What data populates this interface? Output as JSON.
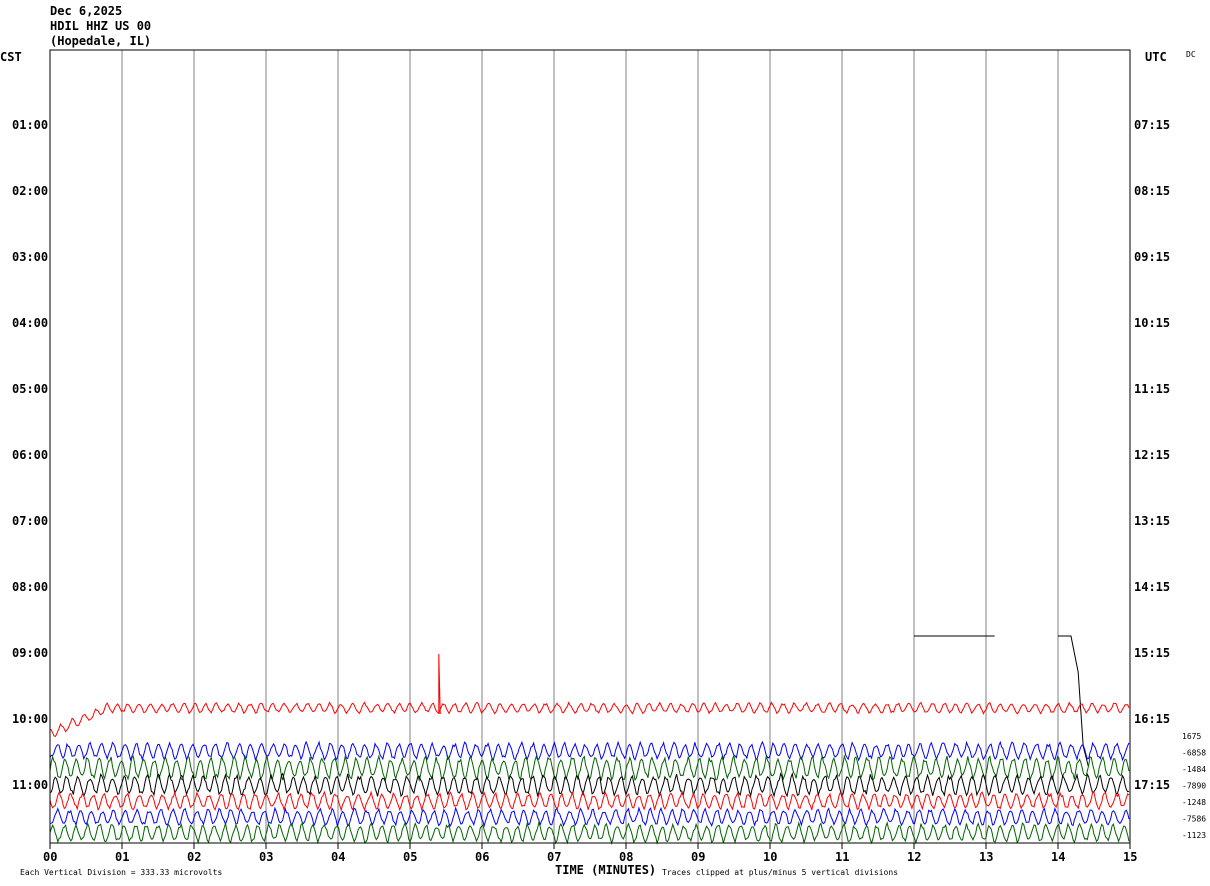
{
  "header": {
    "date": "Dec 6,2025",
    "station": "HDIL HHZ US 00",
    "location": "(Hopedale, IL)"
  },
  "left_axis_title": "CST",
  "right_axis_title": "UTC",
  "corner_tag": "DC",
  "footer": {
    "scale_note": "Each Vertical Division =  333.33 microvolts",
    "xlabel": "TIME (MINUTES)",
    "clip_note": "Traces clipped at plus/minus 5 vertical divisions"
  },
  "chart_data": {
    "type": "line",
    "subtype": "helicorder",
    "xlabel": "TIME (MINUTES)",
    "xlim": [
      0,
      15
    ],
    "x_ticks": [
      "00",
      "01",
      "02",
      "03",
      "04",
      "05",
      "06",
      "07",
      "08",
      "09",
      "10",
      "11",
      "12",
      "13",
      "14",
      "15"
    ],
    "left_hours": [
      "01:00",
      "02:00",
      "03:00",
      "04:00",
      "05:00",
      "06:00",
      "07:00",
      "08:00",
      "09:00",
      "10:00",
      "11:00"
    ],
    "right_hours": [
      "07:15",
      "08:15",
      "09:15",
      "10:15",
      "11:15",
      "12:15",
      "13:15",
      "14:15",
      "15:15",
      "16:15",
      "17:15"
    ],
    "gridlines": "vertical every minute",
    "trace_colors": [
      "#000000",
      "#ff0000",
      "#0000ff",
      "#006400"
    ],
    "active_traces": [
      {
        "row_start": "09:45 CST",
        "color": "#000000",
        "note": "flat line segments with gap (12–13.1 min, 14–14.2 min), then drop near 14.4 min"
      },
      {
        "row_start": "10:00 CST",
        "color": "#ff0000",
        "note": "noisy trace, spike near 5.4 min"
      },
      {
        "row_start": "10:30 CST",
        "color": "#0000ff"
      },
      {
        "row_start": "10:45 CST",
        "color": "#006400"
      },
      {
        "row_start": "11:00 CST",
        "color": "#000000"
      },
      {
        "row_start": "11:15 CST",
        "color": "#ff0000"
      },
      {
        "row_start": "11:30 CST",
        "color": "#0000ff"
      },
      {
        "row_start": "11:45 CST",
        "color": "#006400"
      }
    ],
    "right_values": [
      "1675",
      "-6858",
      "-1484",
      "-7890",
      "-1248",
      "-7586",
      "-1123"
    ]
  }
}
